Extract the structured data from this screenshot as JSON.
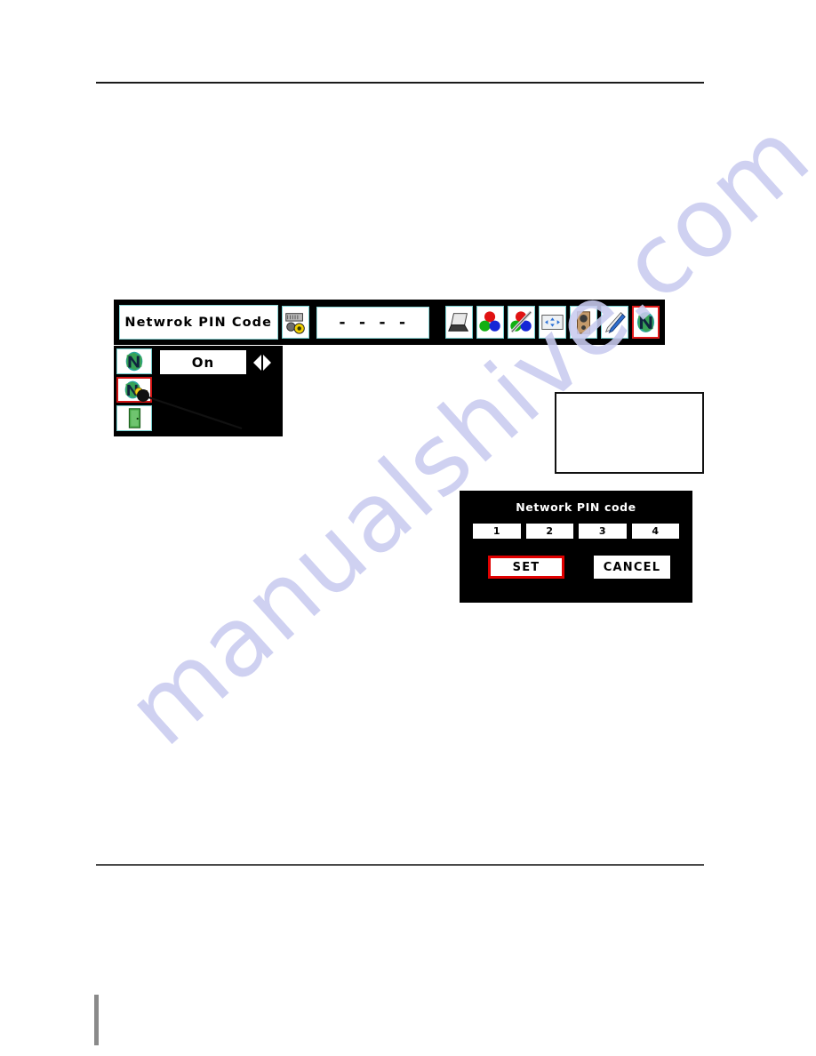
{
  "page": {
    "watermark_text": "manualshive.com",
    "accent_red": "#e01b1b",
    "osd_background": "#000000",
    "icon_border": "#76cfcf"
  },
  "osd_menubar": {
    "title": "Netwrok PIN Code",
    "value": "- - - -",
    "setting_icon_name": "projector-setting-icon",
    "category_icons": [
      {
        "name": "computer-icon",
        "label": "Computer"
      },
      {
        "name": "color-adjust-icon",
        "label": "Color Adjust"
      },
      {
        "name": "image-adjust-icon",
        "label": "Image Adjust"
      },
      {
        "name": "screen-icon",
        "label": "Screen"
      },
      {
        "name": "sound-icon",
        "label": "Sound"
      },
      {
        "name": "setting-tools-icon",
        "label": "Setting"
      },
      {
        "name": "network-icon",
        "label": "Network"
      }
    ],
    "selected_category": "network-icon"
  },
  "osd_subpanel": {
    "sidebar_items": [
      {
        "name": "network-setting-icon",
        "label": "Network setting",
        "selected": false
      },
      {
        "name": "network-pin-code-icon",
        "label": "Network PIN code",
        "selected": true
      },
      {
        "name": "quit-icon",
        "label": "Quit",
        "selected": false
      }
    ],
    "setting_value": "On",
    "left_arrow": "◀",
    "right_arrow": "▶"
  },
  "pin_dialog": {
    "title": "Network PIN code",
    "digits": [
      "1",
      "2",
      "3",
      "4"
    ],
    "set_label": "SET",
    "cancel_label": "CANCEL",
    "selected_button": "SET"
  },
  "note_box": {
    "text": ""
  }
}
